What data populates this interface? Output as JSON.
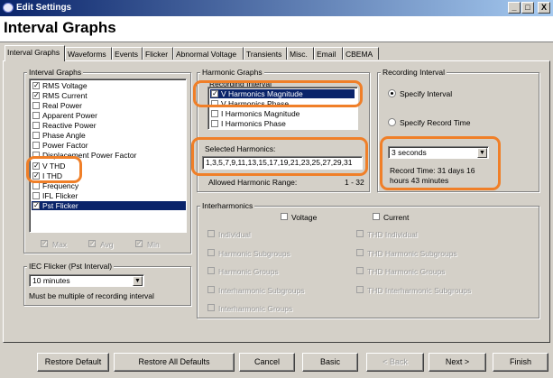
{
  "window": {
    "title": "Edit Settings",
    "minimize": "_",
    "maximize": "□",
    "close": "X"
  },
  "header": {
    "title": "Interval Graphs"
  },
  "tabs": [
    {
      "label": "Interval Graphs"
    },
    {
      "label": "Waveforms"
    },
    {
      "label": "Events"
    },
    {
      "label": "Flicker"
    },
    {
      "label": "Abnormal Voltage"
    },
    {
      "label": "Transients"
    },
    {
      "label": "Misc."
    },
    {
      "label": "Email"
    },
    {
      "label": "CBEMA"
    }
  ],
  "interval_graphs": {
    "label": "Interval Graphs",
    "items": [
      {
        "label": "RMS Voltage",
        "checked": true
      },
      {
        "label": "RMS Current",
        "checked": true
      },
      {
        "label": "Real Power",
        "checked": false
      },
      {
        "label": "Apparent Power",
        "checked": false
      },
      {
        "label": "Reactive Power",
        "checked": false
      },
      {
        "label": "Phase Angle",
        "checked": false
      },
      {
        "label": "Power Factor",
        "checked": false
      },
      {
        "label": "Displacement Power Factor",
        "checked": false
      },
      {
        "label": "V THD",
        "checked": true
      },
      {
        "label": "I THD",
        "checked": true
      },
      {
        "label": "Frequency",
        "checked": false
      },
      {
        "label": "IFL Flicker",
        "checked": false
      },
      {
        "label": "Pst Flicker",
        "checked": true,
        "selected": true
      }
    ],
    "max_label": "Max",
    "avg_label": "Avg",
    "min_label": "Min"
  },
  "iec_flicker": {
    "label": "IEC Flicker (Pst Interval)",
    "value": "10 minutes",
    "note": "Must be multiple of recording interval"
  },
  "harmonic_graphs": {
    "label": "Harmonic Graphs",
    "recording_interval_label": "Recording Interval",
    "items": [
      {
        "label": "V Harmonics Magnitude",
        "checked": true,
        "selected": true
      },
      {
        "label": "V Harmonics Phase",
        "checked": false
      },
      {
        "label": "I Harmonics Magnitude",
        "checked": false
      },
      {
        "label": "I Harmonics Phase",
        "checked": false
      }
    ],
    "selected_harmonics_label": "Selected Harmonics:",
    "selected_harmonics_value": "1,3,5,7,9,11,13,15,17,19,21,23,25,27,29,31",
    "allowed_label": "Allowed Harmonic Range:",
    "allowed_value": "1 - 32"
  },
  "recording_interval": {
    "label": "Recording Interval",
    "specify_interval": "Specify Interval",
    "specify_record_time": "Specify Record Time",
    "interval_value": "3 seconds",
    "record_time_line1": "Record Time: 31 days 16",
    "record_time_line2": "hours 43 minutes"
  },
  "interharmonics": {
    "label": "Interharmonics",
    "voltage": "Voltage",
    "current": "Current",
    "left": [
      "Individual",
      "Harmonic Subgroups",
      "Harmonic Groups",
      "Interharmonic Subgroups",
      "Interharmonic Groups"
    ],
    "right": [
      "THD Individual",
      "THD Harmonic Subgroups",
      "THD Harmonic Groups",
      "THD Interharmonic Subgroups"
    ]
  },
  "buttons": {
    "restore_default": "Restore Default",
    "restore_all": "Restore All Defaults",
    "cancel": "Cancel",
    "basic": "Basic",
    "back": "< Back",
    "next": "Next >",
    "finish": "Finish"
  },
  "colors": {
    "highlight": "#f07f28",
    "selection": "#0a246a"
  }
}
